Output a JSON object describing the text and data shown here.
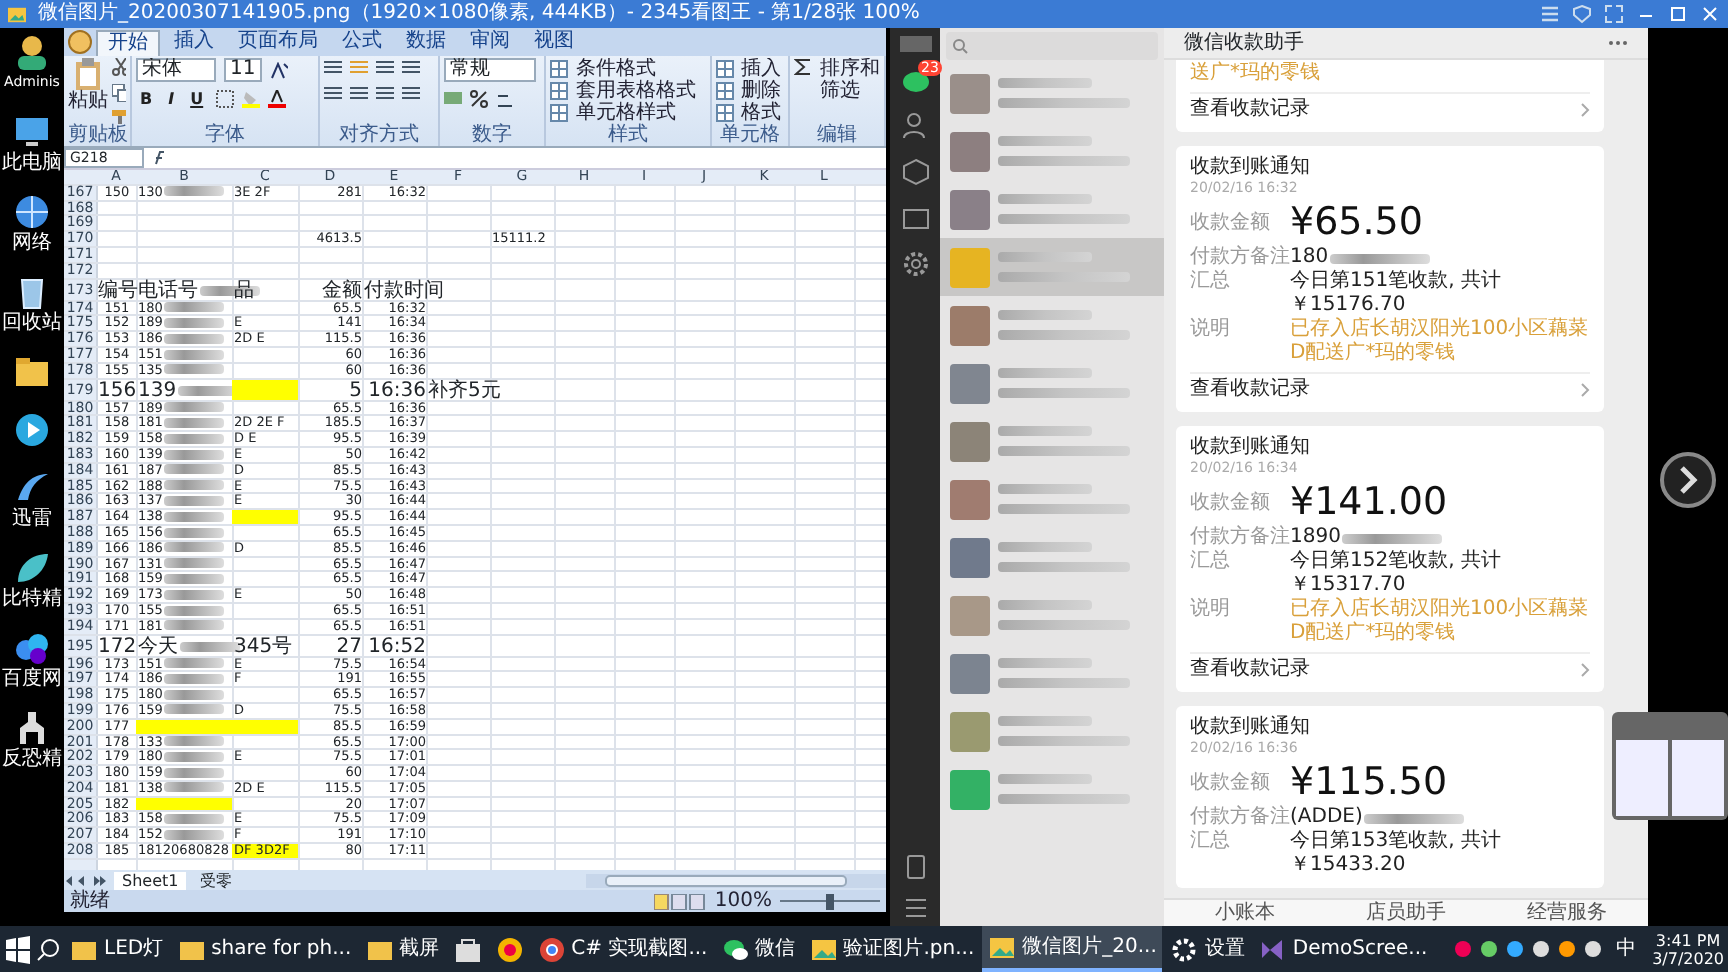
{
  "viewer": {
    "title": "微信图片_20200307141905.png（1920×1080像素, 444KB）- 2345看图王 - 第1/28张 100%"
  },
  "desktop_icons": [
    {
      "kind": "user",
      "label": "Adminis"
    },
    {
      "kind": "computer",
      "label": "此电脑"
    },
    {
      "kind": "network",
      "label": "网络"
    },
    {
      "kind": "recycle",
      "label": "回收站"
    },
    {
      "kind": "folder"
    },
    {
      "kind": "video"
    },
    {
      "kind": "thunder",
      "label": "迅雷"
    },
    {
      "kind": "leaf",
      "label": "比特精"
    },
    {
      "kind": "cloud",
      "label": "百度网"
    },
    {
      "kind": "game",
      "label": "反恐精"
    }
  ],
  "excel": {
    "tabs": [
      {
        "label": "开始",
        "selected": true
      },
      {
        "label": "插入",
        "selected": false
      },
      {
        "label": "页面布局",
        "selected": false
      },
      {
        "label": "公式",
        "selected": false
      },
      {
        "label": "数据",
        "selected": false
      },
      {
        "label": "审阅",
        "selected": false
      },
      {
        "label": "视图",
        "selected": false
      }
    ],
    "groups": [
      {
        "kind": "clipboard",
        "label": "剪贴板",
        "items": [
          "粘贴"
        ]
      },
      {
        "kind": "font",
        "label": "字体",
        "font": "宋体",
        "size": "11",
        "format_buttons": [
          "B",
          "I",
          "U"
        ]
      },
      {
        "kind": "align",
        "label": "对齐方式"
      },
      {
        "kind": "number",
        "label": "数字",
        "format": "常规"
      },
      {
        "kind": "styles",
        "label": "样式",
        "items": [
          "条件格式",
          "套用表格格式",
          "单元格样式"
        ]
      },
      {
        "kind": "cells",
        "label": "单元格",
        "items": [
          "插入",
          "删除",
          "格式"
        ]
      },
      {
        "kind": "editing",
        "label": "编辑",
        "items": [
          "排序和筛选"
        ]
      }
    ],
    "name_box": "G218",
    "columns": [
      "A",
      "B",
      "C",
      "D",
      "E",
      "F",
      "G",
      "H",
      "I",
      "J",
      "K",
      "L"
    ],
    "rows": [
      {
        "n": "167",
        "kind": "data",
        "blurred": true,
        "cells": {
          "a": "150",
          "b": "130",
          "c": "3E 2F",
          "d": "281",
          "e": "16:32"
        }
      },
      {
        "n": "168",
        "kind": "data"
      },
      {
        "n": "169",
        "kind": "data"
      },
      {
        "n": "170",
        "kind": "data",
        "cells": {
          "d": "4613.5",
          "g": "15111.2"
        }
      },
      {
        "n": "171",
        "kind": "data"
      },
      {
        "n": "172",
        "kind": "data"
      },
      {
        "n": "173",
        "kind": "text",
        "blurred": true,
        "cells": {
          "a": "编号",
          "b": "电话号",
          "c": "品",
          "d": "金额",
          "e": "付款时间"
        }
      },
      {
        "n": "174",
        "kind": "data",
        "blurred": true,
        "cells": {
          "a": "151",
          "b": "180",
          "d": "65.5",
          "e": "16:32"
        }
      },
      {
        "n": "175",
        "kind": "data",
        "blurred": true,
        "cells": {
          "a": "152",
          "b": "189",
          "c": "E",
          "d": "141",
          "e": "16:34"
        }
      },
      {
        "n": "176",
        "kind": "data",
        "blurred": true,
        "cells": {
          "a": "153",
          "b": "186",
          "c": "2D E",
          "d": "115.5",
          "e": "16:36"
        }
      },
      {
        "n": "177",
        "kind": "data",
        "blurred": true,
        "cells": {
          "a": "154",
          "b": "151",
          "d": "60",
          "e": "16:36"
        }
      },
      {
        "n": "178",
        "kind": "data",
        "blurred": true,
        "cells": {
          "a": "155",
          "b": "135",
          "d": "60",
          "e": "16:36"
        }
      },
      {
        "n": "179",
        "kind": "text",
        "blurred": true,
        "highlight": {
          "c": true
        },
        "cells": {
          "a": "156",
          "b": "139",
          "d": "5",
          "e": "16:36",
          "f": "补齐5元"
        }
      },
      {
        "n": "180",
        "kind": "data",
        "blurred": true,
        "cells": {
          "a": "157",
          "b": "189",
          "d": "65.5",
          "e": "16:36"
        }
      },
      {
        "n": "181",
        "kind": "data",
        "blurred": true,
        "cells": {
          "a": "158",
          "b": "181",
          "c": "2D 2E F",
          "d": "185.5",
          "e": "16:37"
        }
      },
      {
        "n": "182",
        "kind": "data",
        "blurred": true,
        "cells": {
          "a": "159",
          "b": "158",
          "c": "D E",
          "d": "95.5",
          "e": "16:39"
        }
      },
      {
        "n": "183",
        "kind": "data",
        "blurred": true,
        "cells": {
          "a": "160",
          "b": "139",
          "c": "E",
          "d": "50",
          "e": "16:42"
        }
      },
      {
        "n": "184",
        "kind": "data",
        "blurred": true,
        "cells": {
          "a": "161",
          "b": "187",
          "c": "D",
          "d": "85.5",
          "e": "16:43"
        }
      },
      {
        "n": "185",
        "kind": "data",
        "blurred": true,
        "cells": {
          "a": "162",
          "b": "188",
          "c": "E",
          "d": "75.5",
          "e": "16:43"
        }
      },
      {
        "n": "186",
        "kind": "data",
        "blurred": true,
        "cells": {
          "a": "163",
          "b": "137",
          "c": "E",
          "d": "30",
          "e": "16:44"
        }
      },
      {
        "n": "187",
        "kind": "data",
        "blurred": true,
        "highlight": {
          "c": true
        },
        "cells": {
          "a": "164",
          "b": "138",
          "d": "95.5",
          "e": "16:44"
        }
      },
      {
        "n": "188",
        "kind": "data",
        "blurred": true,
        "cells": {
          "a": "165",
          "b": "156",
          "d": "65.5",
          "e": "16:45"
        }
      },
      {
        "n": "189",
        "kind": "data",
        "blurred": true,
        "cells": {
          "a": "166",
          "b": "186",
          "c": "D",
          "d": "85.5",
          "e": "16:46"
        }
      },
      {
        "n": "190",
        "kind": "data",
        "blurred": true,
        "cells": {
          "a": "167",
          "b": "131",
          "d": "65.5",
          "e": "16:47"
        }
      },
      {
        "n": "191",
        "kind": "data",
        "blurred": true,
        "cells": {
          "a": "168",
          "b": "159",
          "d": "65.5",
          "e": "16:47"
        }
      },
      {
        "n": "192",
        "kind": "data",
        "blurred": true,
        "cells": {
          "a": "169",
          "b": "173",
          "c": "E",
          "d": "50",
          "e": "16:48"
        }
      },
      {
        "n": "193",
        "kind": "data",
        "blurred": true,
        "cells": {
          "a": "170",
          "b": "155",
          "d": "65.5",
          "e": "16:51"
        }
      },
      {
        "n": "194",
        "kind": "data",
        "blurred": true,
        "cells": {
          "a": "171",
          "b": "181",
          "d": "65.5",
          "e": "16:51"
        }
      },
      {
        "n": "195",
        "kind": "text",
        "blurred": true,
        "cells": {
          "a": "172",
          "b": "今天",
          "c": "345号",
          "d": "27",
          "e": "16:52"
        }
      },
      {
        "n": "196",
        "kind": "data",
        "blurred": true,
        "cells": {
          "a": "173",
          "b": "151",
          "c": "E",
          "d": "75.5",
          "e": "16:54"
        }
      },
      {
        "n": "197",
        "kind": "data",
        "blurred": true,
        "cells": {
          "a": "174",
          "b": "186",
          "c": "F",
          "d": "191",
          "e": "16:55"
        }
      },
      {
        "n": "198",
        "kind": "data",
        "blurred": true,
        "cells": {
          "a": "175",
          "b": "180",
          "d": "65.5",
          "e": "16:57"
        }
      },
      {
        "n": "199",
        "kind": "data",
        "blurred": true,
        "cells": {
          "a": "176",
          "b": "159",
          "c": "D",
          "d": "75.5",
          "e": "16:58"
        }
      },
      {
        "n": "200",
        "kind": "data",
        "highlight": {
          "b": true,
          "c": true
        },
        "cells": {
          "a": "177",
          "d": "85.5",
          "e": "16:59"
        }
      },
      {
        "n": "201",
        "kind": "data",
        "blurred": true,
        "cells": {
          "a": "178",
          "b": "133",
          "d": "65.5",
          "e": "17:00"
        }
      },
      {
        "n": "202",
        "kind": "data",
        "blurred": true,
        "cells": {
          "a": "179",
          "b": "180",
          "c": "E",
          "d": "75.5",
          "e": "17:01"
        }
      },
      {
        "n": "203",
        "kind": "data",
        "blurred": true,
        "cells": {
          "a": "180",
          "b": "159",
          "d": "60",
          "e": "17:04"
        }
      },
      {
        "n": "204",
        "kind": "data",
        "blurred": true,
        "cells": {
          "a": "181",
          "b": "138",
          "c": "2D E",
          "d": "115.5",
          "e": "17:05"
        }
      },
      {
        "n": "205",
        "kind": "data",
        "highlight": {
          "b": true
        },
        "cells": {
          "a": "182",
          "d": "20",
          "e": "17:07"
        }
      },
      {
        "n": "206",
        "kind": "data",
        "blurred": true,
        "cells": {
          "a": "183",
          "b": "158",
          "c": "E",
          "d": "75.5",
          "e": "17:09"
        }
      },
      {
        "n": "207",
        "kind": "data",
        "blurred": true,
        "cells": {
          "a": "184",
          "b": "152",
          "c": "F",
          "d": "191",
          "e": "17:10"
        }
      },
      {
        "n": "208",
        "kind": "data",
        "highlight": {
          "c": true
        },
        "cells": {
          "a": "185",
          "b": "18120680828",
          "c": "DF 3D2F",
          "d": "80",
          "e": "17:11"
        }
      }
    ],
    "sheet_tabs": [
      {
        "label": "Sheet1",
        "selected": true
      },
      {
        "label": "受零",
        "selected": false
      }
    ],
    "status": "就绪",
    "zoom": "100%",
    "zoom_slider": {
      "level": 0.5
    }
  },
  "wechat": {
    "badge": "23",
    "chats": [
      {
        "selected": false,
        "color": "#9a8f8a"
      },
      {
        "selected": false,
        "color": "#8d7f80"
      },
      {
        "selected": false,
        "color": "#8a8088"
      },
      {
        "selected": true,
        "color": "#e6b422"
      },
      {
        "selected": false,
        "color": "#9c7c6a"
      },
      {
        "selected": false,
        "color": "#808690"
      },
      {
        "selected": false,
        "color": "#8c8478"
      },
      {
        "selected": false,
        "color": "#a07c70"
      },
      {
        "selected": false,
        "color": "#707a8c"
      },
      {
        "selected": false,
        "color": "#a89888"
      },
      {
        "selected": false,
        "color": "#7c8490"
      },
      {
        "selected": false,
        "color": "#9a9a70"
      },
      {
        "selected": false,
        "color": "#33b165"
      }
    ],
    "header": "微信收款助手",
    "cards": [
      {
        "kind": "partial",
        "note": "送广*玛的零钱",
        "link": "查看收款记录"
      },
      {
        "kind": "full",
        "title": "收款到账通知",
        "date": "20/02/16 16:32",
        "amount_label": "收款金额",
        "amount": "¥65.50",
        "fields": [
          {
            "kind": "plain",
            "label": "付款方备注",
            "value": "180",
            "blurred": true
          },
          {
            "kind": "plain",
            "label": "汇总",
            "value": "今日第151笔收款, 共计￥15176.70"
          },
          {
            "kind": "note",
            "label": "说明",
            "value": "已存入店长胡汉阳光100小区藕菜D配送广*玛的零钱"
          }
        ],
        "link": "查看收款记录"
      },
      {
        "kind": "full",
        "title": "收款到账通知",
        "date": "20/02/16 16:34",
        "amount_label": "收款金额",
        "amount": "¥141.00",
        "fields": [
          {
            "kind": "plain",
            "label": "付款方备注",
            "value": "1890",
            "blurred": true
          },
          {
            "kind": "plain",
            "label": "汇总",
            "value": "今日第152笔收款, 共计￥15317.70"
          },
          {
            "kind": "note",
            "label": "说明",
            "value": "已存入店长胡汉阳光100小区藕菜D配送广*玛的零钱"
          }
        ],
        "link": "查看收款记录"
      },
      {
        "kind": "full",
        "title": "收款到账通知",
        "date": "20/02/16 16:36",
        "amount_label": "收款金额",
        "amount": "¥115.50",
        "fields": [
          {
            "kind": "plain",
            "label": "付款方备注",
            "value": "(ADDE)",
            "blurred": true
          },
          {
            "kind": "plain",
            "label": "汇总",
            "value": "今日第153笔收款, 共计￥15433.20"
          }
        ]
      }
    ],
    "bottom_bar": [
      "小账本",
      "店员助手",
      "经营服务"
    ]
  },
  "taskbar": {
    "items": [
      {
        "kind": "folder",
        "label": "LED灯",
        "selected": false
      },
      {
        "kind": "folder",
        "label": "share for ph...",
        "selected": false
      },
      {
        "kind": "folder",
        "label": "截屏",
        "selected": false
      },
      {
        "kind": "store",
        "selected": false
      },
      {
        "kind": "circle",
        "selected": false
      },
      {
        "kind": "browser",
        "label": "C# 实现截图...",
        "selected": false
      },
      {
        "kind": "chat",
        "label": "微信",
        "selected": false
      },
      {
        "kind": "picture",
        "label": "验证图片.pn...",
        "selected": false
      },
      {
        "kind": "picture",
        "label": "微信图片_20...",
        "selected": true
      },
      {
        "kind": "gear",
        "label": "设置",
        "selected": false
      },
      {
        "kind": "studio",
        "label": "DemoScree...",
        "selected": false
      }
    ],
    "ime": "中",
    "time": "3:41 PM",
    "date": "3/7/2020"
  }
}
